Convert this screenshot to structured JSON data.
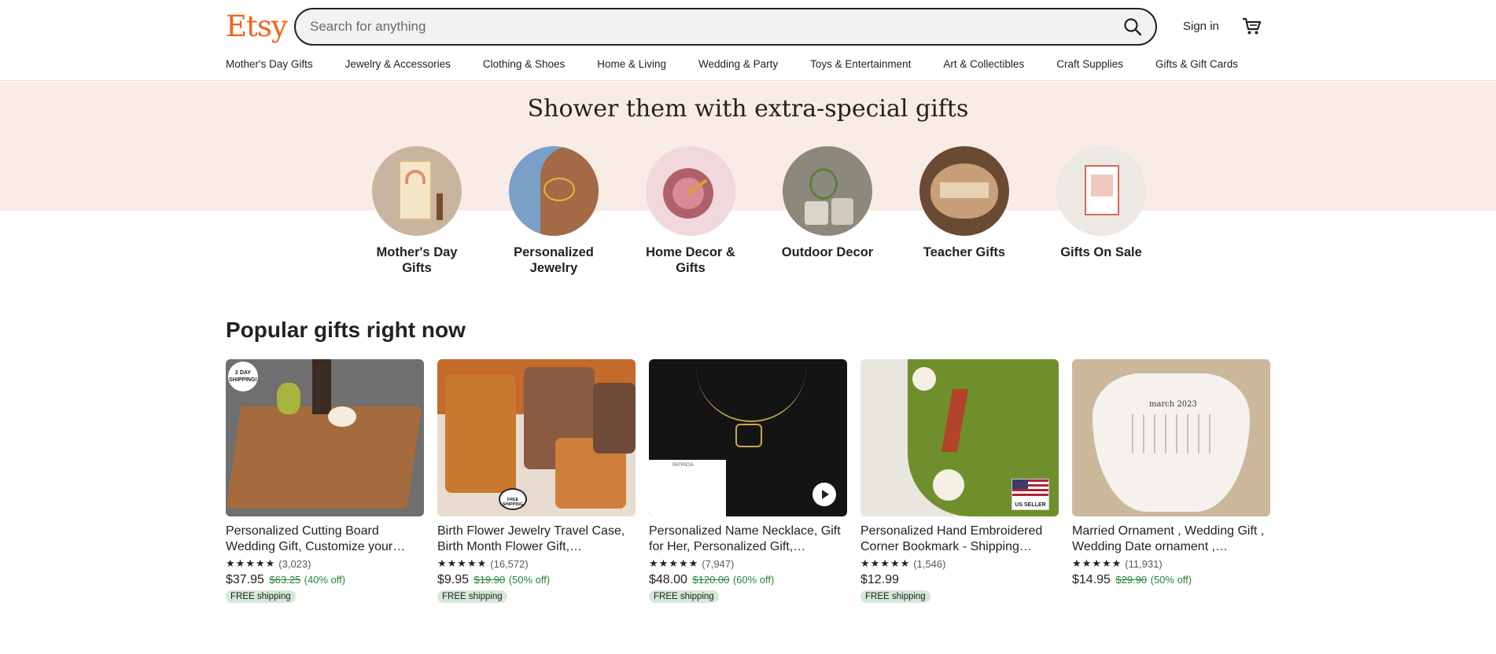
{
  "header": {
    "logo": "Etsy",
    "search_placeholder": "Search for anything",
    "signin": "Sign in"
  },
  "nav": [
    "Mother's Day Gifts",
    "Jewelry & Accessories",
    "Clothing & Shoes",
    "Home & Living",
    "Wedding & Party",
    "Toys & Entertainment",
    "Art & Collectibles",
    "Craft Supplies",
    "Gifts & Gift Cards"
  ],
  "hero": {
    "title": "Shower them with extra-special gifts",
    "categories": [
      {
        "label": "Mother's Day Gifts"
      },
      {
        "label": "Personalized Jewelry"
      },
      {
        "label": "Home Decor & Gifts"
      },
      {
        "label": "Outdoor Decor"
      },
      {
        "label": "Teacher Gifts"
      },
      {
        "label": "Gifts On Sale"
      }
    ]
  },
  "popular": {
    "title": "Popular gifts right now",
    "items": [
      {
        "title": "Personalized Cutting Board Wedding Gift, Customize your…",
        "stars": "★★★★★",
        "reviews": "(3,023)",
        "price": "$37.95",
        "was": "$63.25",
        "off": "(40% off)",
        "badge": "FREE shipping",
        "tag": "2 DAY SHIPPING!"
      },
      {
        "title": "Birth Flower Jewelry Travel Case, Birth Month Flower Gift,…",
        "stars": "★★★★★",
        "reviews": "(16,572)",
        "price": "$9.95",
        "was": "$19.90",
        "off": "(50% off)",
        "badge": "FREE shipping",
        "tag": "FREE SHIPPING"
      },
      {
        "title": "Personalized Name Necklace, Gift for Her, Personalized Gift,…",
        "stars": "★★★★★",
        "reviews": "(7,947)",
        "price": "$48.00",
        "was": "$120.00",
        "off": "(60% off)",
        "badge": "FREE shipping",
        "tag": "PATRICIA"
      },
      {
        "title": "Personalized Hand Embroidered Corner Bookmark - Shipping…",
        "stars": "★★★★★",
        "reviews": "(1,546)",
        "price": "$12.99",
        "was": "",
        "off": "",
        "badge": "FREE shipping",
        "tag": "US SELLER"
      },
      {
        "title": "Married Ornament , Wedding Gift , Wedding Date ornament ,…",
        "stars": "★★★★★",
        "reviews": "(11,931)",
        "price": "$14.95",
        "was": "$29.90",
        "off": "(50% off)",
        "badge": "",
        "tag": "march 2023"
      }
    ]
  },
  "colors": {
    "brand": "#f1641e",
    "hero_band": "#f9ebe6",
    "sale_green": "#258635",
    "badge_green": "#d4e9d7"
  },
  "icons": [
    "search-icon",
    "cart-icon",
    "play-icon",
    "us-flag-icon"
  ]
}
